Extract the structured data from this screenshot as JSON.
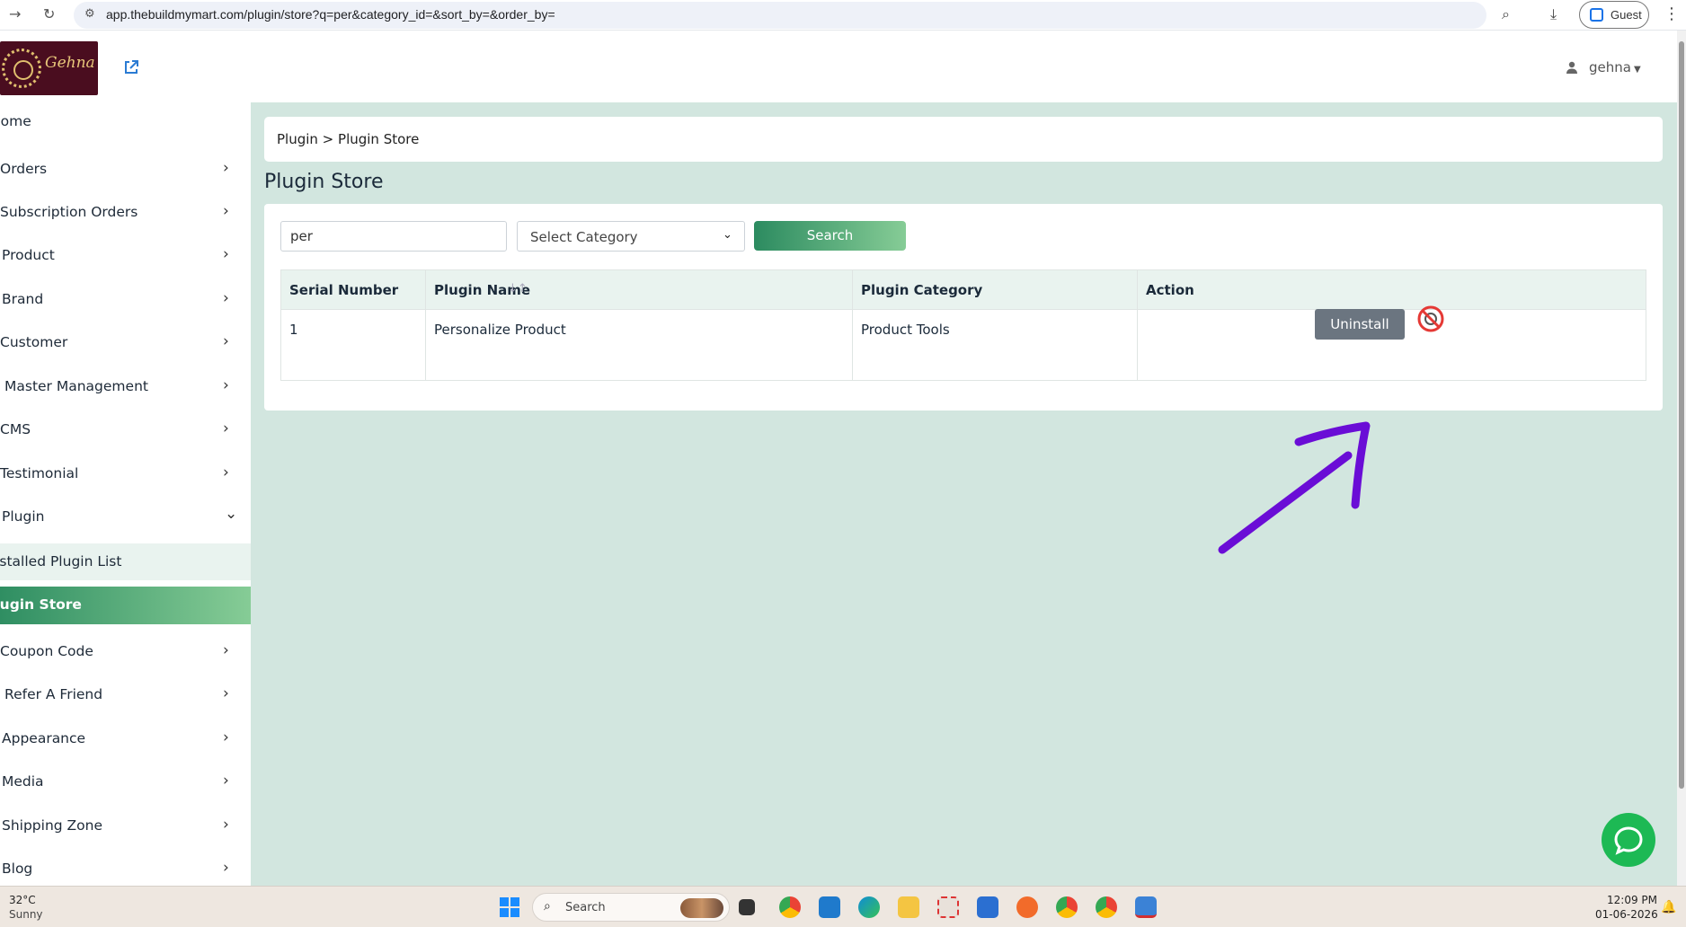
{
  "browser": {
    "url": "app.thebuildmymart.com/plugin/store?q=per&category_id=&sort_by=&order_by=",
    "guest_label": "Guest"
  },
  "header": {
    "logo_text": "Gehna",
    "username": "gehna"
  },
  "sidebar": {
    "items": [
      {
        "label": "Home"
      },
      {
        "label": "Orders"
      },
      {
        "label": "Subscription Orders"
      },
      {
        "label": "Product"
      },
      {
        "label": "Brand"
      },
      {
        "label": "Customer"
      },
      {
        "label": "Master Management"
      },
      {
        "label": "CMS"
      },
      {
        "label": "Testimonial"
      },
      {
        "label": "Plugin"
      },
      {
        "label": "Installed Plugin List"
      },
      {
        "label": "Plugin Store"
      },
      {
        "label": "Coupon Code"
      },
      {
        "label": "Refer A Friend"
      },
      {
        "label": "Appearance"
      },
      {
        "label": "Media"
      },
      {
        "label": "Shipping Zone"
      },
      {
        "label": "Blog"
      }
    ]
  },
  "main": {
    "breadcrumb": "Plugin > Plugin Store",
    "title": "Plugin Store",
    "search_value": "per",
    "category_placeholder": "Select Category",
    "search_button": "Search",
    "table": {
      "headers": [
        "Serial Number",
        "Plugin Name",
        "Plugin Category",
        "Action"
      ],
      "rows": [
        {
          "serial": "1",
          "name": "Personalize Product",
          "category": "Product Tools",
          "action": "Uninstall"
        }
      ]
    }
  },
  "taskbar": {
    "temperature": "32°C",
    "condition": "Sunny",
    "search_label": "Search",
    "time": "12:09 PM",
    "date": "01-06-2026"
  },
  "colors": {
    "accent_green": "#2f8e62",
    "page_bg": "#d2e6df",
    "annotation_purple": "#6a0dd6",
    "chat_green": "#1db954"
  }
}
